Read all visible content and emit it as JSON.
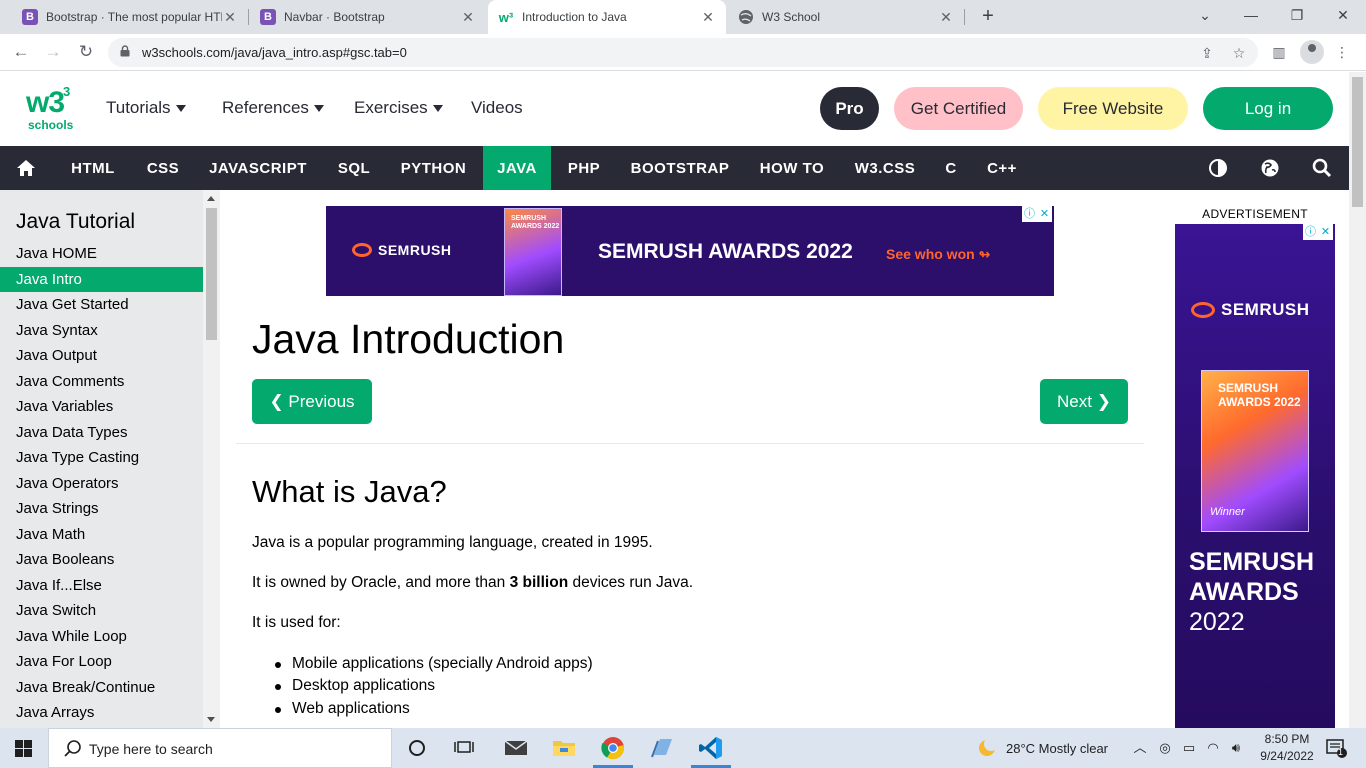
{
  "browser": {
    "tabs": [
      {
        "title": "Bootstrap · The most popular HTML",
        "icon": "bootstrap-favicon",
        "color": "#7952b3",
        "letter": "B",
        "active": false
      },
      {
        "title": "Navbar · Bootstrap",
        "icon": "bootstrap-favicon",
        "color": "#7952b3",
        "letter": "B",
        "active": false
      },
      {
        "title": "Introduction to Java",
        "icon": "w3schools-favicon",
        "color": "#04aa6d",
        "letter": "w",
        "active": true
      },
      {
        "title": "W3 School",
        "icon": "globe-favicon",
        "color": "#5f6368",
        "letter": "",
        "active": false
      }
    ],
    "url": "w3schools.com/java/java_intro.asp#gsc.tab=0"
  },
  "site": {
    "logo": {
      "main": "w3",
      "sup": "3",
      "sub": "schools"
    },
    "menu": [
      {
        "label": "Tutorials",
        "dropdown": true
      },
      {
        "label": "References",
        "dropdown": true
      },
      {
        "label": "Exercises",
        "dropdown": true
      },
      {
        "label": "Videos",
        "dropdown": false
      }
    ],
    "pills": {
      "pro": "Pro",
      "certified": "Get Certified",
      "free_website": "Free Website",
      "login": "Log in"
    },
    "colors": {
      "brand": "#04aa6d",
      "dark": "#282a35",
      "sidebar": "#e7e9eb",
      "certified": "#ffc0c7",
      "free_website": "#fff4a3"
    },
    "nav": [
      "HTML",
      "CSS",
      "JAVASCRIPT",
      "SQL",
      "PYTHON",
      "JAVA",
      "PHP",
      "BOOTSTRAP",
      "HOW TO",
      "W3.CSS",
      "C",
      "C++"
    ],
    "nav_active": "JAVA"
  },
  "sidebar": {
    "title": "Java Tutorial",
    "items": [
      "Java HOME",
      "Java Intro",
      "Java Get Started",
      "Java Syntax",
      "Java Output",
      "Java Comments",
      "Java Variables",
      "Java Data Types",
      "Java Type Casting",
      "Java Operators",
      "Java Strings",
      "Java Math",
      "Java Booleans",
      "Java If...Else",
      "Java Switch",
      "Java While Loop",
      "Java For Loop",
      "Java Break/Continue",
      "Java Arrays"
    ],
    "active": "Java Intro"
  },
  "ad_banner": {
    "brand": "SEMRUSH",
    "headline": "SEMRUSH AWARDS 2022",
    "cta": "See who won ↬",
    "trophy_text": "SEMRUSH AWARDS 2022"
  },
  "main": {
    "title": "Java Introduction",
    "prev": "❮ Previous",
    "next": "Next ❯",
    "section_title": "What is Java?",
    "p1": "Java is a popular programming language, created in 1995.",
    "p2_before": "It is owned by Oracle, and more than ",
    "p2_bold": "3 billion",
    "p2_after": " devices run Java.",
    "p3": "It is used for:",
    "uses": [
      "Mobile applications (specially Android apps)",
      "Desktop applications",
      "Web applications"
    ]
  },
  "ad_sky": {
    "label": "ADVERTISEMENT",
    "brand": "SEMRUSH",
    "trophy_text": "SEMRUSH AWARDS 2022",
    "trophy_winner": "Winner",
    "line1": "SEMRUSH",
    "line2": "AWARDS",
    "line3": "2022"
  },
  "taskbar": {
    "search_placeholder": "Type here to search",
    "weather": "28°C  Mostly clear",
    "time": "8:50 PM",
    "date": "9/24/2022",
    "notifications": "1"
  }
}
